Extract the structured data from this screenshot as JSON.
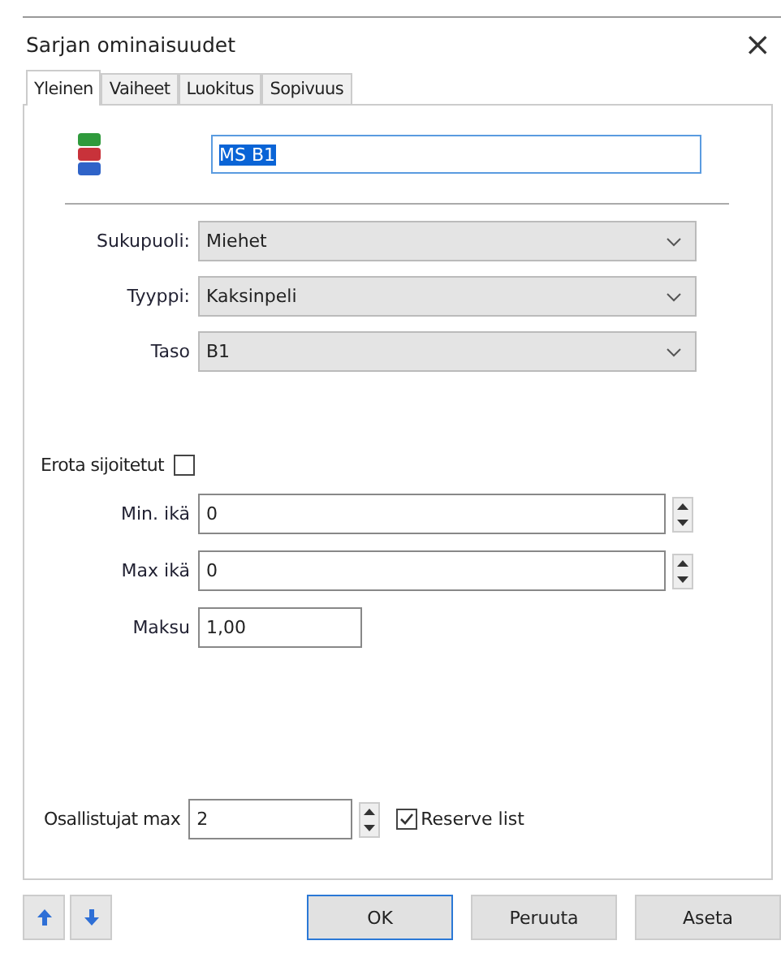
{
  "window": {
    "title": "Sarjan ominaisuudet",
    "close": "×"
  },
  "tabs": [
    {
      "label": "Yleinen",
      "selected": true
    },
    {
      "label": "Vaiheet",
      "selected": false
    },
    {
      "label": "Luokitus",
      "selected": false
    },
    {
      "label": "Sopivuus",
      "selected": false
    }
  ],
  "name_field": {
    "value": "MS B1",
    "selected": true
  },
  "dropdowns": [
    {
      "label": "Sukupuoli:",
      "value": "Miehet"
    },
    {
      "label": "Tyyppi:",
      "value": "Kaksinpeli"
    },
    {
      "label": "Taso",
      "value": "B1"
    }
  ],
  "separate_seeded": {
    "label": "Erota sijoitetut",
    "checked": false
  },
  "numbers": [
    {
      "label": "Min. ikä",
      "value": "0",
      "kind": "spin"
    },
    {
      "label": "Max ikä",
      "value": "0",
      "kind": "spin"
    },
    {
      "label": "Maksu",
      "value": "1,00",
      "kind": "plain"
    }
  ],
  "participants": {
    "label": "Osallistujat max",
    "value": "2",
    "reserve_list": {
      "label": "Reserve list",
      "checked": true
    }
  },
  "buttons": [
    {
      "label": "OK",
      "default": true
    },
    {
      "label": "Peruuta",
      "default": false
    },
    {
      "label": "Aseta",
      "default": false
    }
  ]
}
